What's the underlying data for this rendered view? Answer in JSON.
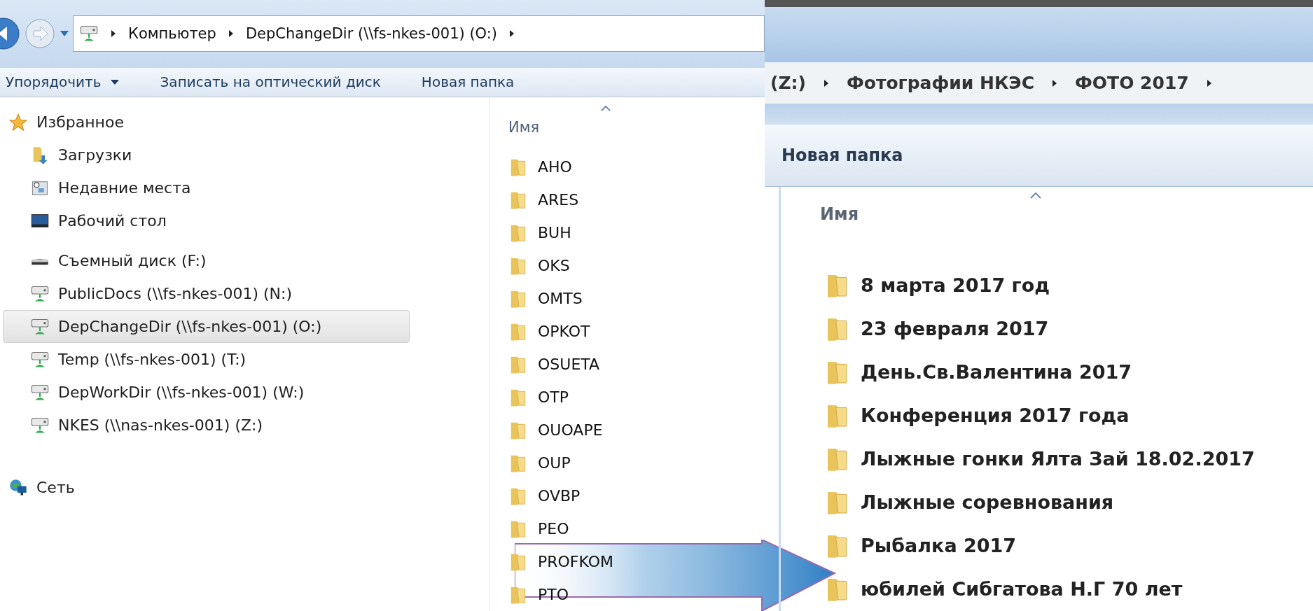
{
  "left_window": {
    "breadcrumb": [
      "Компьютер",
      "DepChangeDir (\\\\fs-nkes-001) (O:)"
    ],
    "toolbar": [
      {
        "label": "Упорядочить",
        "has_menu": true
      },
      {
        "label": "Записать на оптический диск",
        "has_menu": false
      },
      {
        "label": "Новая папка",
        "has_menu": false
      }
    ],
    "sidebar": {
      "favorites": {
        "label": "Избранное",
        "children": [
          {
            "label": "Загрузки",
            "kind": "downloads",
            "selected": false
          },
          {
            "label": "Недавние места",
            "kind": "recent",
            "selected": false
          },
          {
            "label": "Рабочий стол",
            "kind": "desktop",
            "selected": false
          }
        ]
      },
      "drives": [
        {
          "label": "Съемный диск (F:)",
          "kind": "removable",
          "selected": false
        },
        {
          "label": "PublicDocs (\\\\fs-nkes-001) (N:)",
          "kind": "network_drive",
          "selected": false
        },
        {
          "label": "DepChangeDir (\\\\fs-nkes-001) (O:)",
          "kind": "network_drive",
          "selected": true
        },
        {
          "label": "Temp (\\\\fs-nkes-001) (T:)",
          "kind": "network_drive",
          "selected": false
        },
        {
          "label": "DepWorkDir (\\\\fs-nkes-001) (W:)",
          "kind": "network_drive",
          "selected": false
        },
        {
          "label": "NKES (\\\\nas-nkes-001) (Z:)",
          "kind": "network_drive",
          "selected": false
        }
      ],
      "network": {
        "label": "Сеть"
      }
    },
    "column_header": "Имя",
    "folders": [
      "AHO",
      "ARES",
      "BUH",
      "OKS",
      "OMTS",
      "OPKOT",
      "OSUETA",
      "OTP",
      "OUOAPE",
      "OUP",
      "OVBP",
      "PEO",
      "PROFKOM",
      "PTO"
    ]
  },
  "right_window": {
    "breadcrumb": [
      "(Z:)",
      "Фотографии НКЭС",
      "ФОТО 2017"
    ],
    "toolbar": [
      "Новая папка"
    ],
    "column_header": "Имя",
    "folders": [
      "8 марта 2017 год",
      "23 февраля 2017",
      "День.Св.Валентина 2017",
      "Конференция 2017 года",
      "Лыжные гонки Ялта Зай 18.02.2017",
      "Лыжные соревнования",
      "Рыбалка 2017",
      "юбилей Сибгатова Н.Г 70 лет"
    ]
  }
}
